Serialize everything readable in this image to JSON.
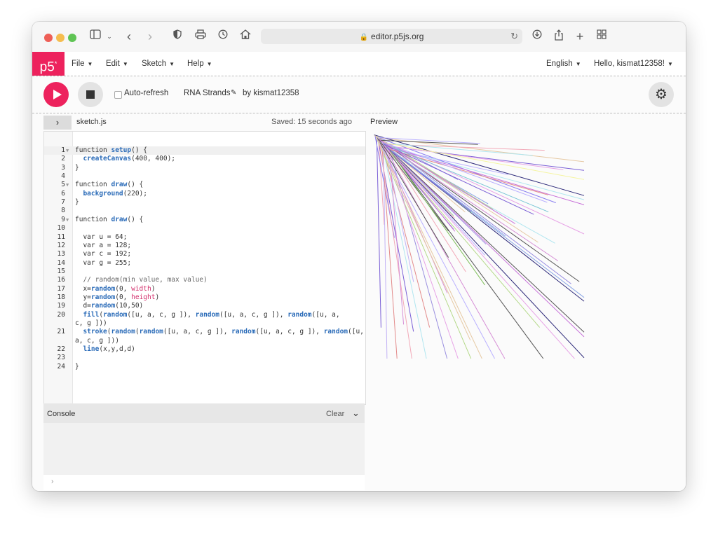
{
  "browser": {
    "url": "editor.p5js.org"
  },
  "menu": {
    "logo": "p5",
    "logo_sup": "*",
    "items": [
      "File",
      "Edit",
      "Sketch",
      "Help"
    ],
    "language": "English",
    "user": "Hello, kismat12358!"
  },
  "toolbar": {
    "auto_refresh": "Auto-refresh",
    "sketch_name": "RNA Strands",
    "by_user": "by kismat12358"
  },
  "editor": {
    "filename": "sketch.js",
    "saved": "Saved: 15 seconds ago",
    "preview_label": "Preview",
    "lines": [
      {
        "n": "1",
        "text": "function setup() {"
      },
      {
        "n": "2",
        "text": "  createCanvas(400, 400);"
      },
      {
        "n": "3",
        "text": "}"
      },
      {
        "n": "4",
        "text": ""
      },
      {
        "n": "5",
        "text": "function draw() {"
      },
      {
        "n": "6",
        "text": "  background(220);"
      },
      {
        "n": "7",
        "text": "}"
      },
      {
        "n": "8",
        "text": ""
      },
      {
        "n": "9",
        "text": "function draw() {"
      },
      {
        "n": "10",
        "text": ""
      },
      {
        "n": "11",
        "text": "  var u = 64;"
      },
      {
        "n": "12",
        "text": "  var a = 128;"
      },
      {
        "n": "13",
        "text": "  var c = 192;"
      },
      {
        "n": "14",
        "text": "  var g = 255;"
      },
      {
        "n": "15",
        "text": ""
      },
      {
        "n": "16",
        "text": "  // random(min value, max value)"
      },
      {
        "n": "17",
        "text": "  x=random(0, width)"
      },
      {
        "n": "18",
        "text": "  y=random(0, height)"
      },
      {
        "n": "19",
        "text": "  d=random(10,50)"
      },
      {
        "n": "20",
        "text": "  fill(random([u, a, c, g ]), random([u, a, c, g ]), random([u, a,"
      },
      {
        "n": "",
        "text": "c, g ]))"
      },
      {
        "n": "21",
        "text": "  stroke(random(random([u, a, c, g ]), random([u, a, c, g ]), random([u,"
      },
      {
        "n": "",
        "text": "a, c, g ]))"
      },
      {
        "n": "22",
        "text": "  line(x,y,d,d)"
      },
      {
        "n": "23",
        "text": ""
      },
      {
        "n": "24",
        "text": "}"
      }
    ]
  },
  "console": {
    "title": "Console",
    "clear": "Clear",
    "prompt": "›"
  }
}
